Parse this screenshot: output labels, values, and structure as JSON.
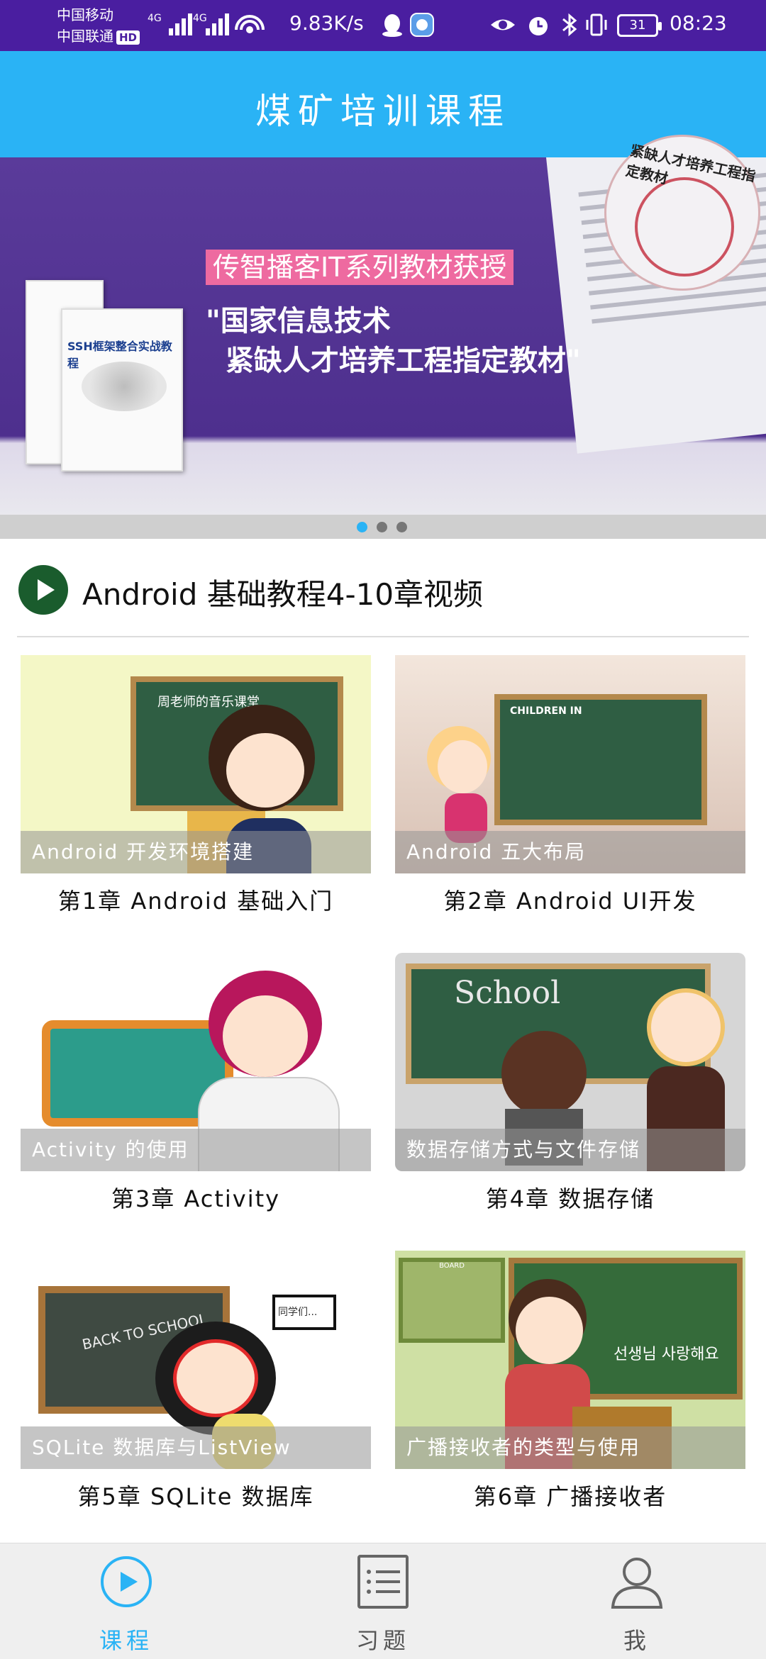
{
  "status_bar": {
    "carrier_1": "中国移动",
    "carrier_2": "中国联通",
    "hd_badge": "HD",
    "network_1": "4G",
    "network_2": "4G",
    "speed": "9.83K/s",
    "battery": "31",
    "time": "08:23"
  },
  "header": {
    "title": "煤矿培训课程"
  },
  "banner": {
    "badge": "传智播客IT系列教材获授",
    "quote": "\"国家信息技术\n  紧缺人才培养工程指定教材\"",
    "seal_text": "紧缺人才培养工程指定教材",
    "book_title": "SSH框架整合实战教程",
    "active_slide": 1,
    "slide_count": 3,
    "colors": {
      "active_dot": "#2ab3f5",
      "inactive_dot": "#777777"
    }
  },
  "section": {
    "title": "Android 基础教程4-10章视频"
  },
  "courses": [
    {
      "caption": "Android 开发环境搭建",
      "chapter": "第1章 Android 基础入门"
    },
    {
      "caption": "Android 五大布局",
      "chapter": "第2章 Android UI开发"
    },
    {
      "caption": "Activity 的使用",
      "chapter": "第3章 Activity"
    },
    {
      "caption": "数据存储方式与文件存储",
      "chapter": "第4章 数据存储"
    },
    {
      "caption": "SQLite 数据库与ListView",
      "chapter": "第5章 SQLite 数据库"
    },
    {
      "caption": "广播接收者的类型与使用",
      "chapter": "第6章 广播接收者"
    }
  ],
  "thumb_text": {
    "music_board": "周老师的音乐课堂",
    "children_board": "CHILDREN IN",
    "school_board": "School",
    "back_to_school": "BACK TO SCHOOL",
    "speech": "同学们...",
    "board_sign": "BOARD",
    "korean": "선생님 사랑해요"
  },
  "bottom_nav": [
    {
      "label": "课程",
      "icon": "play-circle-icon",
      "active": true
    },
    {
      "label": "习题",
      "icon": "clipboard-list-icon",
      "active": false
    },
    {
      "label": "我",
      "icon": "user-icon",
      "active": false
    }
  ],
  "theme": {
    "primary": "#2ab3f5",
    "status_bar": "#4a1ea0",
    "section_icon": "#1a5c2d"
  }
}
